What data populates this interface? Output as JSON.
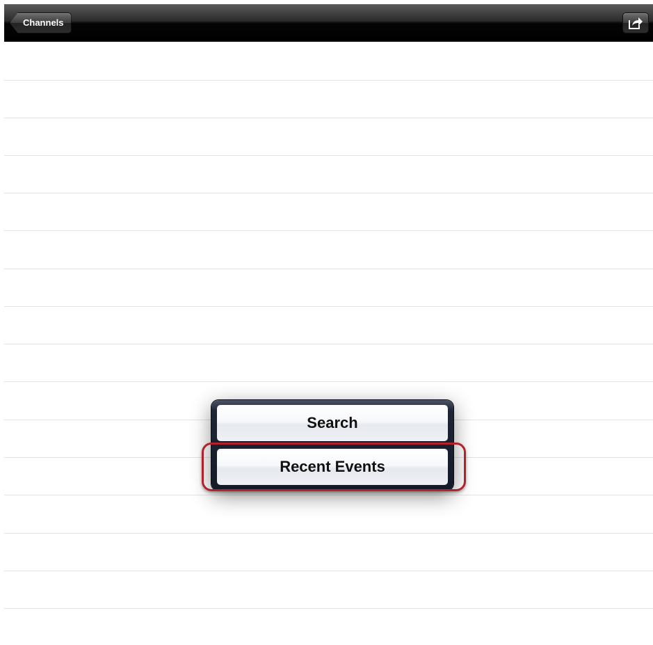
{
  "navbar": {
    "back_label": "Channels",
    "share_icon": "share-icon"
  },
  "popover": {
    "items": [
      {
        "label": "Search"
      },
      {
        "label": "Recent Events"
      }
    ]
  },
  "colors": {
    "navbar": "#000000",
    "highlight": "#b0232a",
    "separator": "#e2e2e2"
  }
}
